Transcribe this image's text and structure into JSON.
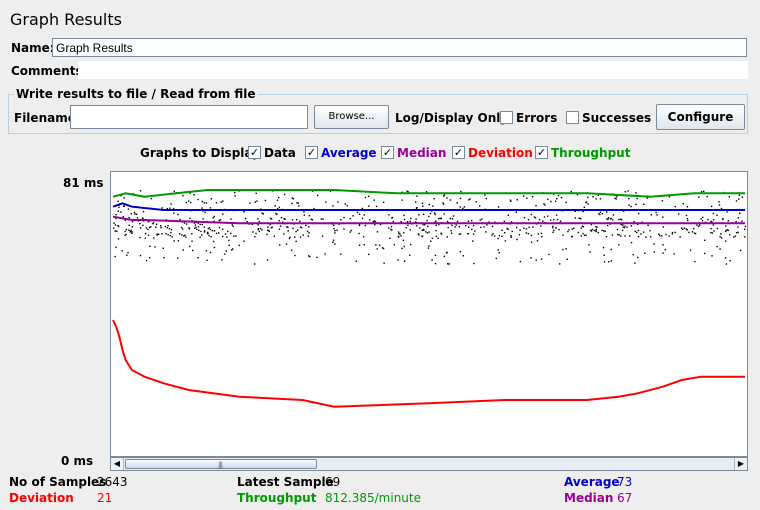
{
  "window": {
    "title": "Graph Results"
  },
  "name_field": {
    "label": "Name:",
    "value": "Graph Results"
  },
  "comments_field": {
    "label": "Comments:",
    "value": ""
  },
  "file_panel": {
    "legend": "Write results to file / Read from file",
    "filename_label": "Filename",
    "filename_value": "",
    "browse_label": "Browse...",
    "log_display_label": "Log/Display Only:",
    "errors_label": "Errors",
    "errors_checked": false,
    "successes_label": "Successes",
    "successes_checked": false,
    "configure_label": "Configure"
  },
  "graphs_to_display": {
    "label": "Graphs to Display",
    "options": [
      {
        "label": "Data",
        "checked": true,
        "color": "#000000"
      },
      {
        "label": "Average",
        "checked": true,
        "color": "#0000cc"
      },
      {
        "label": "Median",
        "checked": true,
        "color": "#990099"
      },
      {
        "label": "Deviation",
        "checked": true,
        "color": "#ff0000"
      },
      {
        "label": "Throughput",
        "checked": true,
        "color": "#009900"
      }
    ]
  },
  "graph": {
    "y_max_label": "81  ms",
    "y_min_label": "0  ms"
  },
  "chart_data": {
    "type": "line",
    "ylim": [
      0,
      81
    ],
    "y_unit": "ms",
    "series": [
      {
        "name": "Average",
        "color": "#0000cc",
        "points": [
          [
            0,
            73
          ],
          [
            1.5,
            74
          ],
          [
            3,
            73
          ],
          [
            8,
            72
          ],
          [
            30,
            72
          ],
          [
            50,
            72
          ],
          [
            70,
            72
          ],
          [
            80,
            72
          ],
          [
            100,
            72
          ]
        ]
      },
      {
        "name": "Median",
        "color": "#990099",
        "points": [
          [
            0,
            70
          ],
          [
            3,
            69
          ],
          [
            5,
            69
          ],
          [
            20,
            68
          ],
          [
            60,
            68
          ],
          [
            100,
            68
          ]
        ]
      },
      {
        "name": "Deviation",
        "color": "#ff0000",
        "points": [
          [
            0,
            39
          ],
          [
            0.5,
            37
          ],
          [
            1,
            34
          ],
          [
            1.5,
            30
          ],
          [
            2,
            27
          ],
          [
            3,
            24
          ],
          [
            5,
            22
          ],
          [
            8,
            20
          ],
          [
            12,
            18
          ],
          [
            20,
            16
          ],
          [
            30,
            15
          ],
          [
            35,
            13
          ],
          [
            50,
            14
          ],
          [
            62,
            15
          ],
          [
            75,
            15
          ],
          [
            80,
            16
          ],
          [
            83,
            17
          ],
          [
            87,
            19
          ],
          [
            90,
            21
          ],
          [
            93,
            22
          ],
          [
            100,
            22
          ]
        ]
      },
      {
        "name": "Throughput",
        "color": "#009900",
        "points": [
          [
            0,
            76
          ],
          [
            2,
            77
          ],
          [
            5,
            76
          ],
          [
            10,
            77
          ],
          [
            15,
            78
          ],
          [
            25,
            78
          ],
          [
            35,
            78
          ],
          [
            45,
            77
          ],
          [
            55,
            77
          ],
          [
            65,
            77
          ],
          [
            75,
            77
          ],
          [
            85,
            76
          ],
          [
            92,
            77
          ],
          [
            100,
            77
          ]
        ]
      }
    ]
  },
  "stats": {
    "no_of_samples_label": "No of Samples",
    "no_of_samples_value": "2643",
    "latest_sample_label": "Latest Sample",
    "latest_sample_value": "69",
    "average_label": "Average",
    "average_value": "73",
    "deviation_label": "Deviation",
    "deviation_value": "21",
    "throughput_label": "Throughput",
    "throughput_value": "812.385/minute",
    "median_label": "Median",
    "median_value": "67"
  },
  "colors": {
    "average": "#0000cc",
    "median": "#990099",
    "deviation": "#ff0000",
    "throughput": "#009900"
  }
}
